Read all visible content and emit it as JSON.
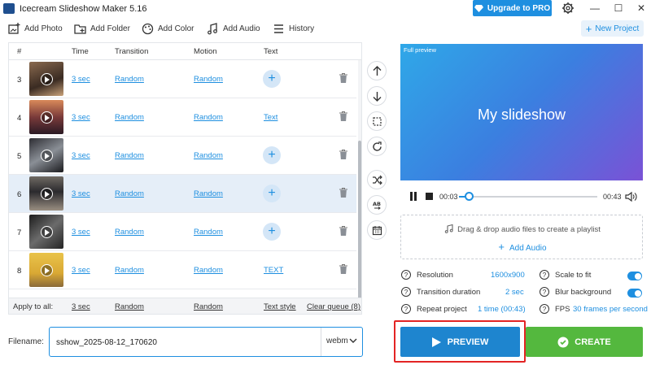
{
  "app": {
    "title": "Icecream Slideshow Maker 5.16",
    "upgrade_label": "Upgrade to PRO"
  },
  "toolbar": {
    "add_photo": "Add Photo",
    "add_folder": "Add Folder",
    "add_color": "Add Color",
    "add_audio": "Add Audio",
    "history": "History",
    "new_project": "New Project"
  },
  "table": {
    "headers": {
      "num": "#",
      "time": "Time",
      "transition": "Transition",
      "motion": "Motion",
      "text": "Text"
    },
    "rows": [
      {
        "num": "3",
        "time": "3 sec",
        "transition": "Random",
        "motion": "Random",
        "text": "",
        "selected": false
      },
      {
        "num": "4",
        "time": "3 sec",
        "transition": "Random",
        "motion": "Random",
        "text": "Text",
        "selected": false
      },
      {
        "num": "5",
        "time": "3 sec",
        "transition": "Random",
        "motion": "Random",
        "text": "",
        "selected": false
      },
      {
        "num": "6",
        "time": "3 sec",
        "transition": "Random",
        "motion": "Random",
        "text": "",
        "selected": true
      },
      {
        "num": "7",
        "time": "3 sec",
        "transition": "Random",
        "motion": "Random",
        "text": "",
        "selected": false
      },
      {
        "num": "8",
        "time": "3 sec",
        "transition": "Random",
        "motion": "Random",
        "text": "TEXT",
        "selected": false
      }
    ],
    "apply_all": {
      "label": "Apply to all:",
      "time": "3 sec",
      "transition": "Random",
      "motion": "Random",
      "text_style": "Text style",
      "clear_queue": "Clear queue (8)"
    }
  },
  "filename": {
    "label": "Filename:",
    "value": "sshow_2025-08-12_170620",
    "format": "webm"
  },
  "preview": {
    "label": "Full preview",
    "title": "My slideshow",
    "current_time": "00:03",
    "total_time": "00:43",
    "progress": 0.07
  },
  "audio": {
    "hint": "Drag & drop audio files to create a playlist",
    "add_label": "Add Audio"
  },
  "settings": {
    "resolution_label": "Resolution",
    "resolution_value": "1600x900",
    "transition_label": "Transition duration",
    "transition_value": "2 sec",
    "repeat_label": "Repeat project",
    "repeat_value": "1 time (00:43)",
    "scale_label": "Scale to fit",
    "scale_on": true,
    "blur_label": "Blur background",
    "blur_on": true,
    "fps_label": "FPS",
    "fps_value": "30 frames per second"
  },
  "buttons": {
    "preview": "PREVIEW",
    "create": "CREATE"
  },
  "colors": {
    "accent": "#1e8fe0",
    "create": "#54b83e",
    "highlight": "#e32424"
  }
}
